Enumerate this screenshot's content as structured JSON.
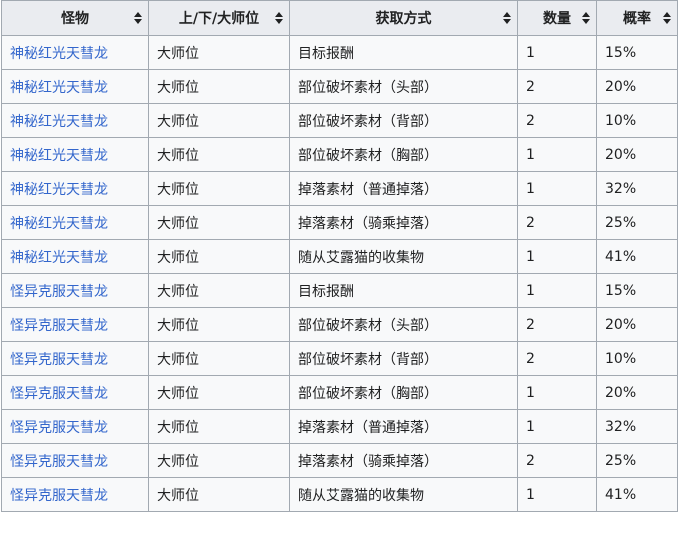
{
  "table": {
    "headers": [
      {
        "label": "怪物",
        "sortable": true
      },
      {
        "label": "上/下/大师位",
        "sortable": true
      },
      {
        "label": "获取方式",
        "sortable": true
      },
      {
        "label": "数量",
        "sortable": true
      },
      {
        "label": "概率",
        "sortable": true
      }
    ],
    "rows": [
      {
        "monster": "神秘红光天彗龙",
        "rank": "大师位",
        "method": "目标报酬",
        "count": "1",
        "rate": "15%"
      },
      {
        "monster": "神秘红光天彗龙",
        "rank": "大师位",
        "method": "部位破坏素材（头部）",
        "count": "2",
        "rate": "20%"
      },
      {
        "monster": "神秘红光天彗龙",
        "rank": "大师位",
        "method": "部位破坏素材（背部）",
        "count": "2",
        "rate": "10%"
      },
      {
        "monster": "神秘红光天彗龙",
        "rank": "大师位",
        "method": "部位破坏素材（胸部）",
        "count": "1",
        "rate": "20%"
      },
      {
        "monster": "神秘红光天彗龙",
        "rank": "大师位",
        "method": "掉落素材（普通掉落）",
        "count": "1",
        "rate": "32%"
      },
      {
        "monster": "神秘红光天彗龙",
        "rank": "大师位",
        "method": "掉落素材（骑乘掉落）",
        "count": "2",
        "rate": "25%"
      },
      {
        "monster": "神秘红光天彗龙",
        "rank": "大师位",
        "method": "随从艾露猫的收集物",
        "count": "1",
        "rate": "41%"
      },
      {
        "monster": "怪异克服天彗龙",
        "rank": "大师位",
        "method": "目标报酬",
        "count": "1",
        "rate": "15%"
      },
      {
        "monster": "怪异克服天彗龙",
        "rank": "大师位",
        "method": "部位破坏素材（头部）",
        "count": "2",
        "rate": "20%"
      },
      {
        "monster": "怪异克服天彗龙",
        "rank": "大师位",
        "method": "部位破坏素材（背部）",
        "count": "2",
        "rate": "10%"
      },
      {
        "monster": "怪异克服天彗龙",
        "rank": "大师位",
        "method": "部位破坏素材（胸部）",
        "count": "1",
        "rate": "20%"
      },
      {
        "monster": "怪异克服天彗龙",
        "rank": "大师位",
        "method": "掉落素材（普通掉落）",
        "count": "1",
        "rate": "32%"
      },
      {
        "monster": "怪异克服天彗龙",
        "rank": "大师位",
        "method": "掉落素材（骑乘掉落）",
        "count": "2",
        "rate": "25%"
      },
      {
        "monster": "怪异克服天彗龙",
        "rank": "大师位",
        "method": "随从艾露猫的收集物",
        "count": "1",
        "rate": "41%"
      }
    ]
  },
  "colors": {
    "link": "#3366cc",
    "header_bg": "#eaecf0",
    "cell_bg": "#f8f9fa",
    "border": "#a2a9b1",
    "text": "#202122"
  },
  "icons": {
    "sort": "sort-arrows-icon"
  }
}
